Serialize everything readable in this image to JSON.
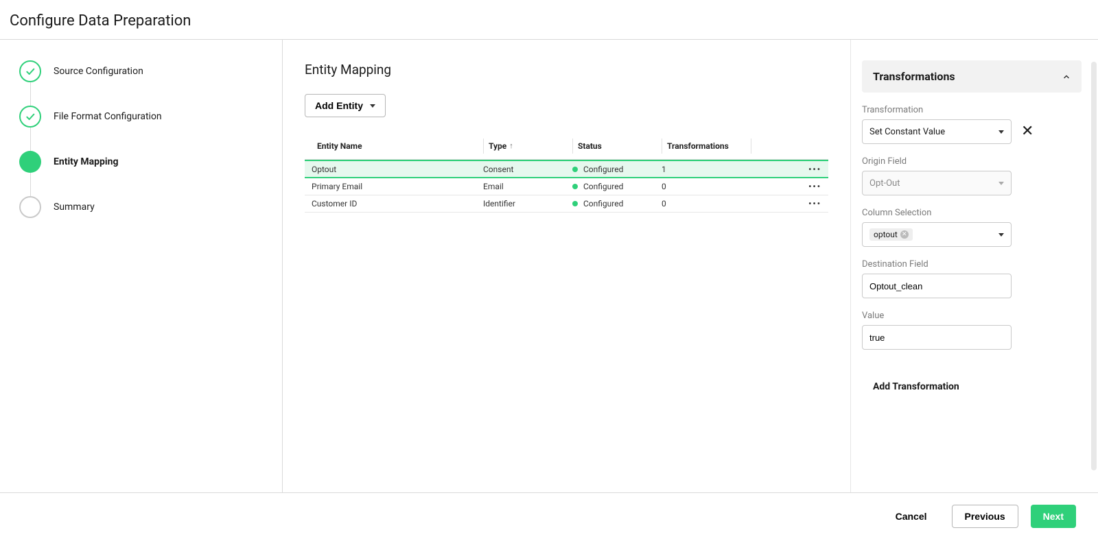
{
  "page_title": "Configure Data Preparation",
  "wizard": {
    "steps": [
      {
        "label": "Source Configuration",
        "state": "done"
      },
      {
        "label": "File Format Configuration",
        "state": "done"
      },
      {
        "label": "Entity Mapping",
        "state": "current"
      },
      {
        "label": "Summary",
        "state": "pending"
      }
    ]
  },
  "main": {
    "title": "Entity Mapping",
    "add_entity_label": "Add Entity",
    "columns": {
      "entity_name": "Entity Name",
      "type": "Type",
      "status": "Status",
      "transformations": "Transformations"
    },
    "rows": [
      {
        "entity_name": "Optout",
        "type": "Consent",
        "status": "Configured",
        "transformations": "1",
        "selected": true
      },
      {
        "entity_name": "Primary Email",
        "type": "Email",
        "status": "Configured",
        "transformations": "0",
        "selected": false
      },
      {
        "entity_name": "Customer ID",
        "type": "Identifier",
        "status": "Configured",
        "transformations": "0",
        "selected": false
      }
    ]
  },
  "panel": {
    "title": "Transformations",
    "transformation_label": "Transformation",
    "transformation_value": "Set Constant Value",
    "origin_label": "Origin Field",
    "origin_value": "Opt-Out",
    "column_label": "Column Selection",
    "column_chip": "optout",
    "dest_label": "Destination Field",
    "dest_value": "Optout_clean",
    "value_label": "Value",
    "value_value": "true",
    "add_transformation": "Add Transformation"
  },
  "footer": {
    "cancel": "Cancel",
    "previous": "Previous",
    "next": "Next"
  }
}
